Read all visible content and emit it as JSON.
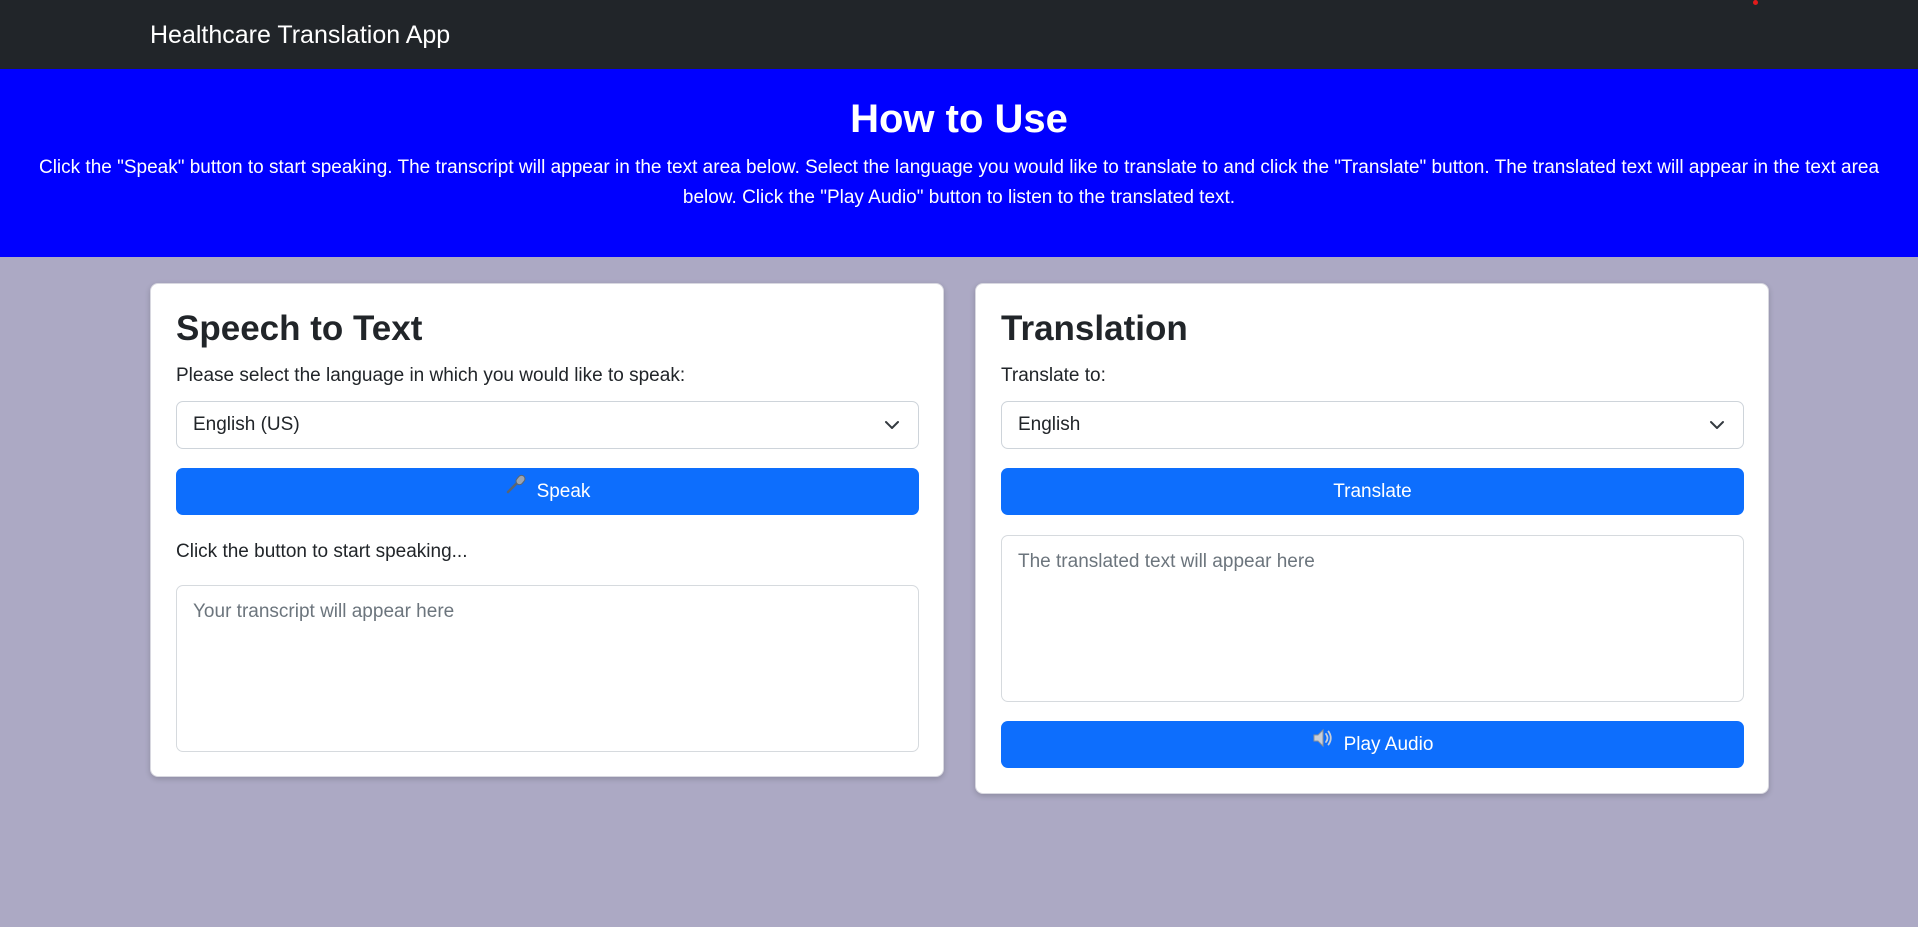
{
  "navbar": {
    "brand": "Healthcare Translation App"
  },
  "hero": {
    "title": "How to Use",
    "instructions": "Click the \"Speak\" button to start speaking. The transcript will appear in the text area below. Select the language you would like to translate to and click the \"Translate\" button. The translated text will appear in the text area below. Click the \"Play Audio\" button to listen to the translated text."
  },
  "speech_card": {
    "title": "Speech to Text",
    "language_label": "Please select the language in which you would like to speak:",
    "language_selected": "English (US)",
    "speak_button": "Speak",
    "speak_icon": "microphone-icon",
    "status_text": "Click the button to start speaking...",
    "transcript_placeholder": "Your transcript will appear here"
  },
  "translation_card": {
    "title": "Translation",
    "language_label": "Translate to:",
    "language_selected": "English",
    "translate_button": "Translate",
    "output_placeholder": "The translated text will appear here",
    "play_button": "Play Audio",
    "play_icon": "speaker-icon"
  },
  "colors": {
    "navbar": "#212529",
    "hero": "#0000ff",
    "page_background": "#aca9c4",
    "primary_button": "#0d6efd"
  }
}
